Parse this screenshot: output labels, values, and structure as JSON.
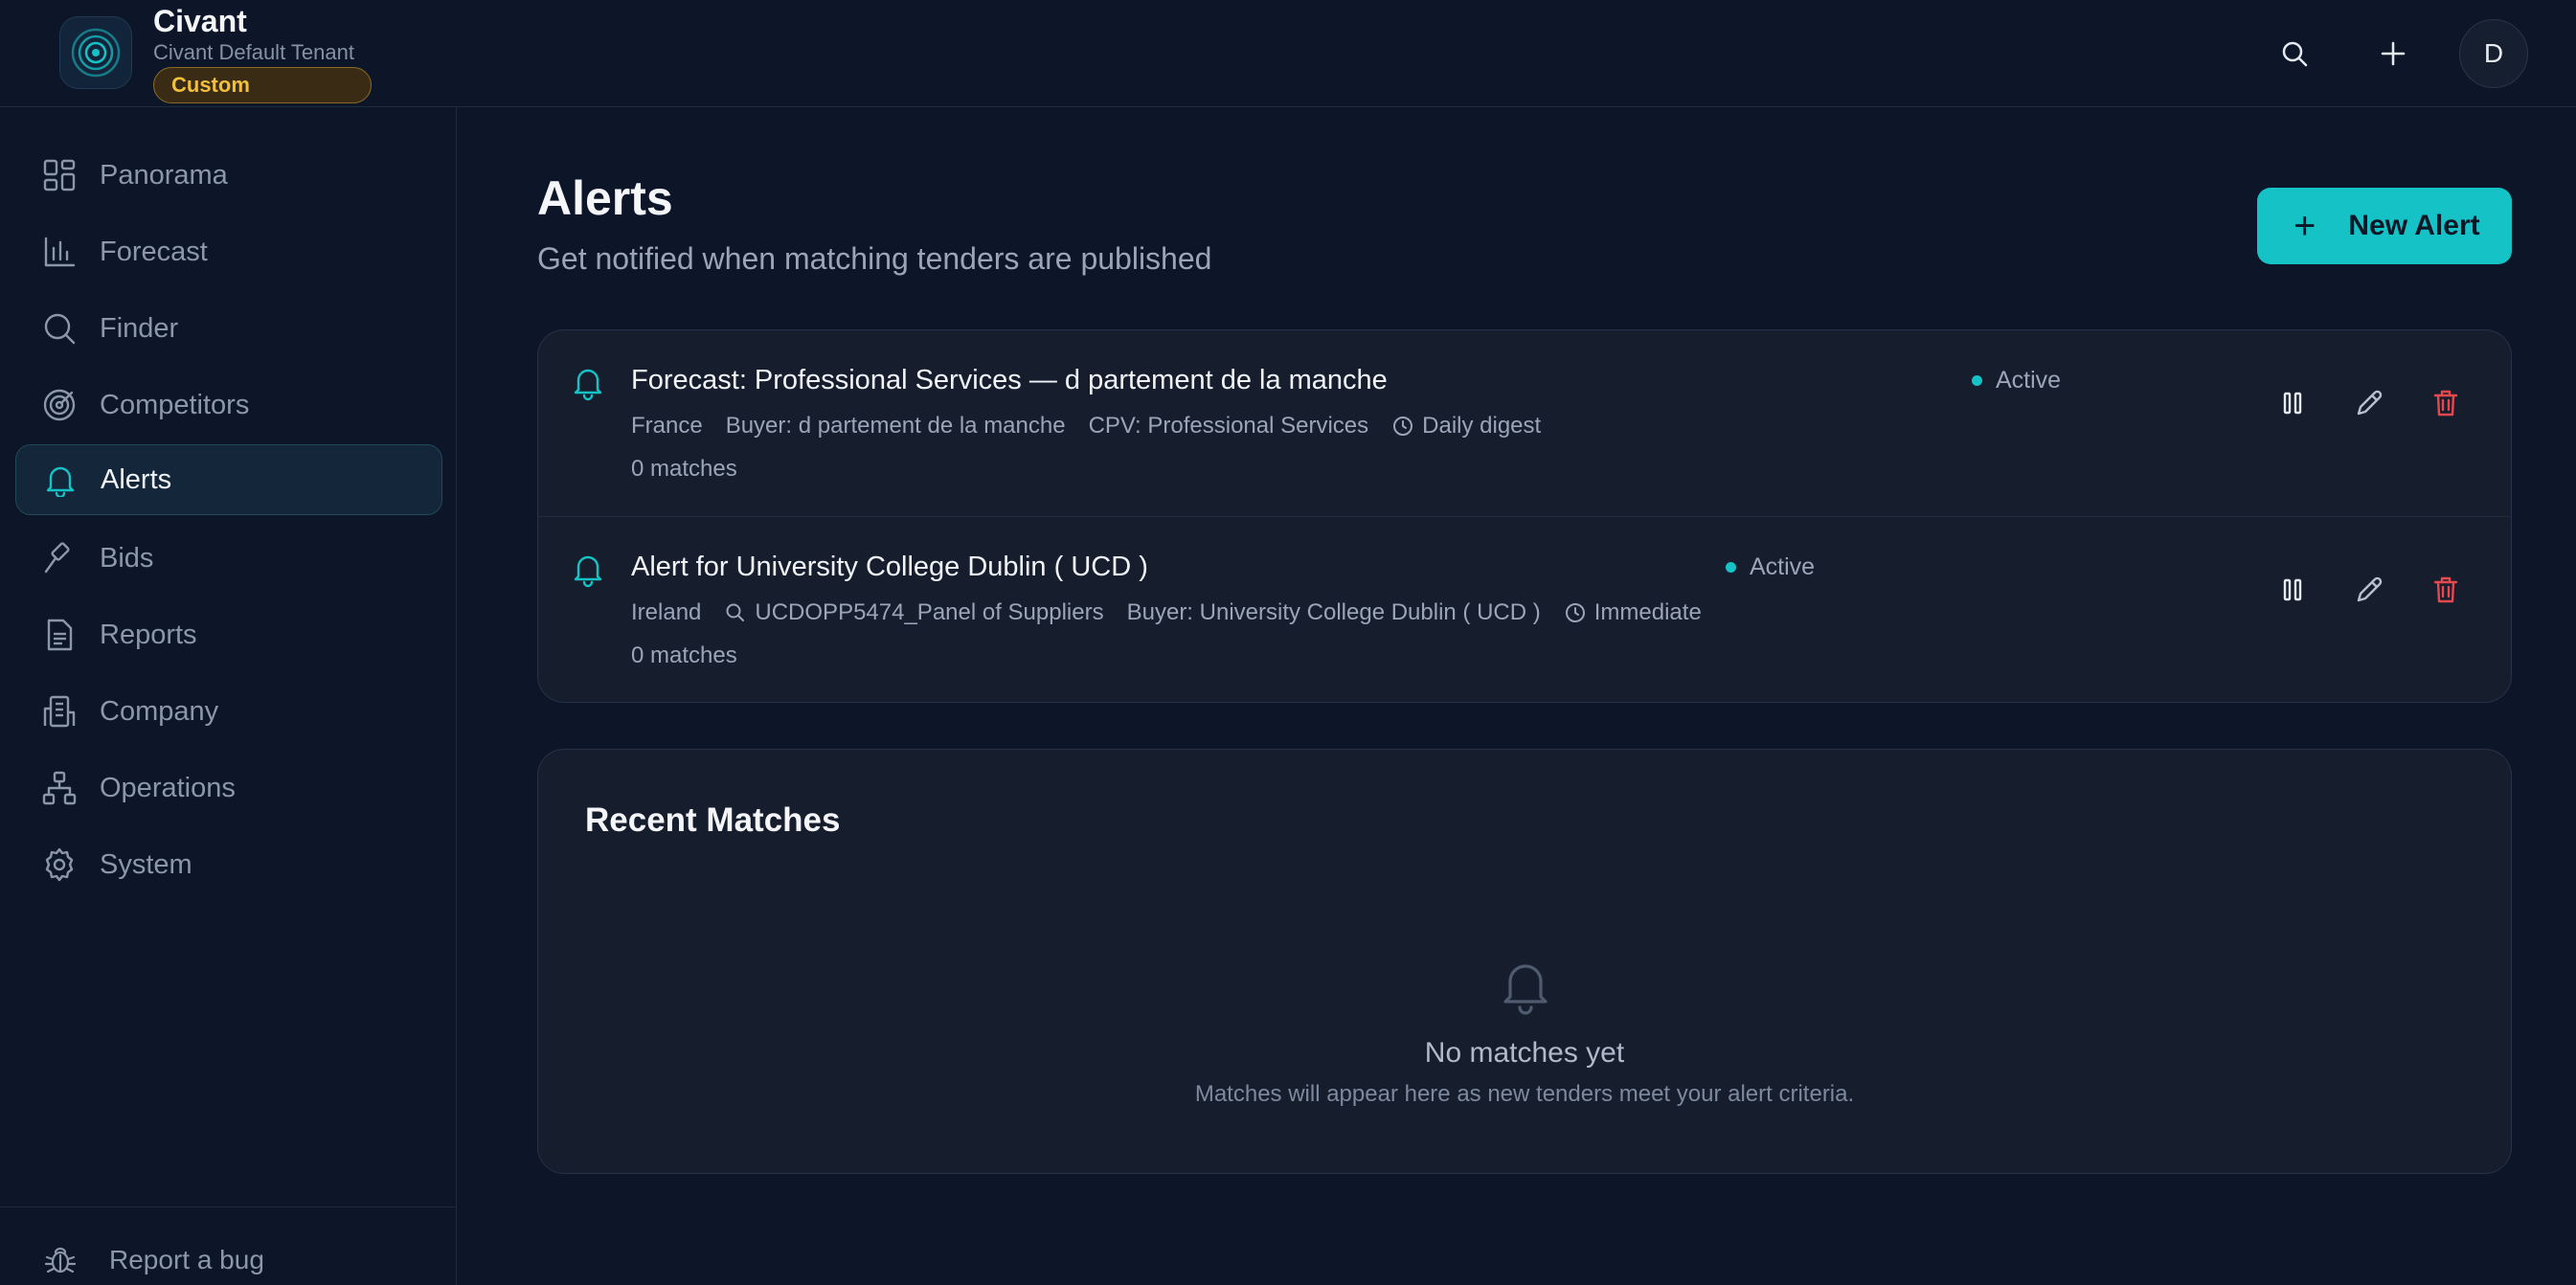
{
  "brand": {
    "name": "Civant",
    "tenant": "Civant Default Tenant",
    "badge": "Custom"
  },
  "header": {
    "search_icon": "search-icon",
    "add_icon": "plus-icon",
    "avatar_initial": "D"
  },
  "sidebar": {
    "items": [
      {
        "label": "Panorama",
        "icon": "dashboard-icon"
      },
      {
        "label": "Forecast",
        "icon": "bar-chart-icon"
      },
      {
        "label": "Finder",
        "icon": "search-icon"
      },
      {
        "label": "Competitors",
        "icon": "target-icon"
      },
      {
        "label": "Alerts",
        "icon": "bell-icon",
        "active": true
      },
      {
        "label": "Bids",
        "icon": "gavel-icon"
      },
      {
        "label": "Reports",
        "icon": "document-icon"
      },
      {
        "label": "Company",
        "icon": "building-icon"
      },
      {
        "label": "Operations",
        "icon": "network-icon"
      },
      {
        "label": "System",
        "icon": "gear-icon"
      }
    ],
    "footer_label": "Report a bug"
  },
  "main": {
    "title": "Alerts",
    "subtitle": "Get notified when matching tenders are published",
    "new_alert_label": "New Alert"
  },
  "alerts": [
    {
      "title": "Forecast: Professional Services — d partement de la manche",
      "status": "Active",
      "country": "France",
      "buyer": "Buyer: d partement de la manche",
      "cpv": "CPV: Professional Services",
      "frequency": "Daily digest",
      "matches": "0 matches"
    },
    {
      "title": "Alert for University College Dublin ( UCD )",
      "status": "Active",
      "country": "Ireland",
      "keyword": "UCDOPP5474_Panel of Suppliers",
      "buyer": "Buyer: University College Dublin ( UCD )",
      "frequency": "Immediate",
      "matches": "0 matches"
    }
  ],
  "recent": {
    "title": "Recent Matches",
    "empty_title": "No matches yet",
    "empty_sub": "Matches will appear here as new tenders meet your alert criteria."
  },
  "colors": {
    "background": "#0d1628",
    "accent": "#15c3c7",
    "danger": "#e5484d",
    "badge": "#f2bf3c"
  }
}
